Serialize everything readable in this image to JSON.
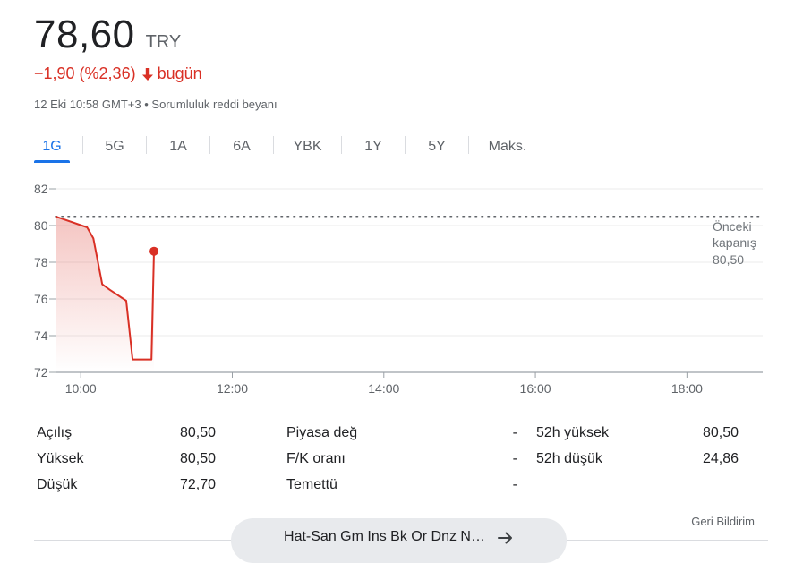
{
  "header": {
    "price": "78,60",
    "currency": "TRY",
    "change": "−1,90 (%2,36)",
    "period": "bugün",
    "timestamp": "12 Eki 10:58 GMT+3",
    "separator": "•",
    "disclaimer": "Sorumluluk reddi beyanı"
  },
  "tabs": [
    {
      "label": "1G",
      "active": true
    },
    {
      "label": "5G"
    },
    {
      "label": "1A"
    },
    {
      "label": "6A"
    },
    {
      "label": "YBK"
    },
    {
      "label": "1Y"
    },
    {
      "label": "5Y"
    },
    {
      "label": "Maks."
    }
  ],
  "colors": {
    "accent": "#1a73e8",
    "negative": "#d93025",
    "grid": "#ebebeb",
    "axis": "#9aa0a6",
    "muted": "#5f6368"
  },
  "chart_data": {
    "type": "line",
    "x_ticks": [
      "10:00",
      "12:00",
      "14:00",
      "16:00",
      "18:00"
    ],
    "y_ticks": [
      72,
      74,
      76,
      78,
      80,
      82
    ],
    "ylim": [
      72,
      82
    ],
    "xlim": [
      "09:40",
      "19:00"
    ],
    "series": [
      {
        "points": [
          {
            "x": "09:40",
            "y": 80.5
          },
          {
            "x": "10:05",
            "y": 79.9
          },
          {
            "x": "10:10",
            "y": 79.3
          },
          {
            "x": "10:17",
            "y": 76.8
          },
          {
            "x": "10:23",
            "y": 76.5
          },
          {
            "x": "10:36",
            "y": 75.9
          },
          {
            "x": "10:41",
            "y": 72.7
          },
          {
            "x": "10:56",
            "y": 72.7
          },
          {
            "x": "10:58",
            "y": 78.6
          }
        ]
      }
    ],
    "previous_close": {
      "label_line1": "Önceki",
      "label_line2": "kapanış",
      "value": "80,50",
      "y": 80.5
    }
  },
  "stats": [
    {
      "label": "Açılış",
      "value": "80,50"
    },
    {
      "label": "Yüksek",
      "value": "80,50"
    },
    {
      "label": "Düşük",
      "value": "72,70"
    },
    {
      "label": "Piyasa değ",
      "value": "-"
    },
    {
      "label": "F/K oranı",
      "value": "-"
    },
    {
      "label": "Temettü",
      "value": "-"
    },
    {
      "label": "52h yüksek",
      "value": "80,50"
    },
    {
      "label": "52h düşük",
      "value": "24,86"
    }
  ],
  "feedback": "Geri Bildirim",
  "more_button": "Hat-San Gm Ins Bk Or Dnz N…"
}
